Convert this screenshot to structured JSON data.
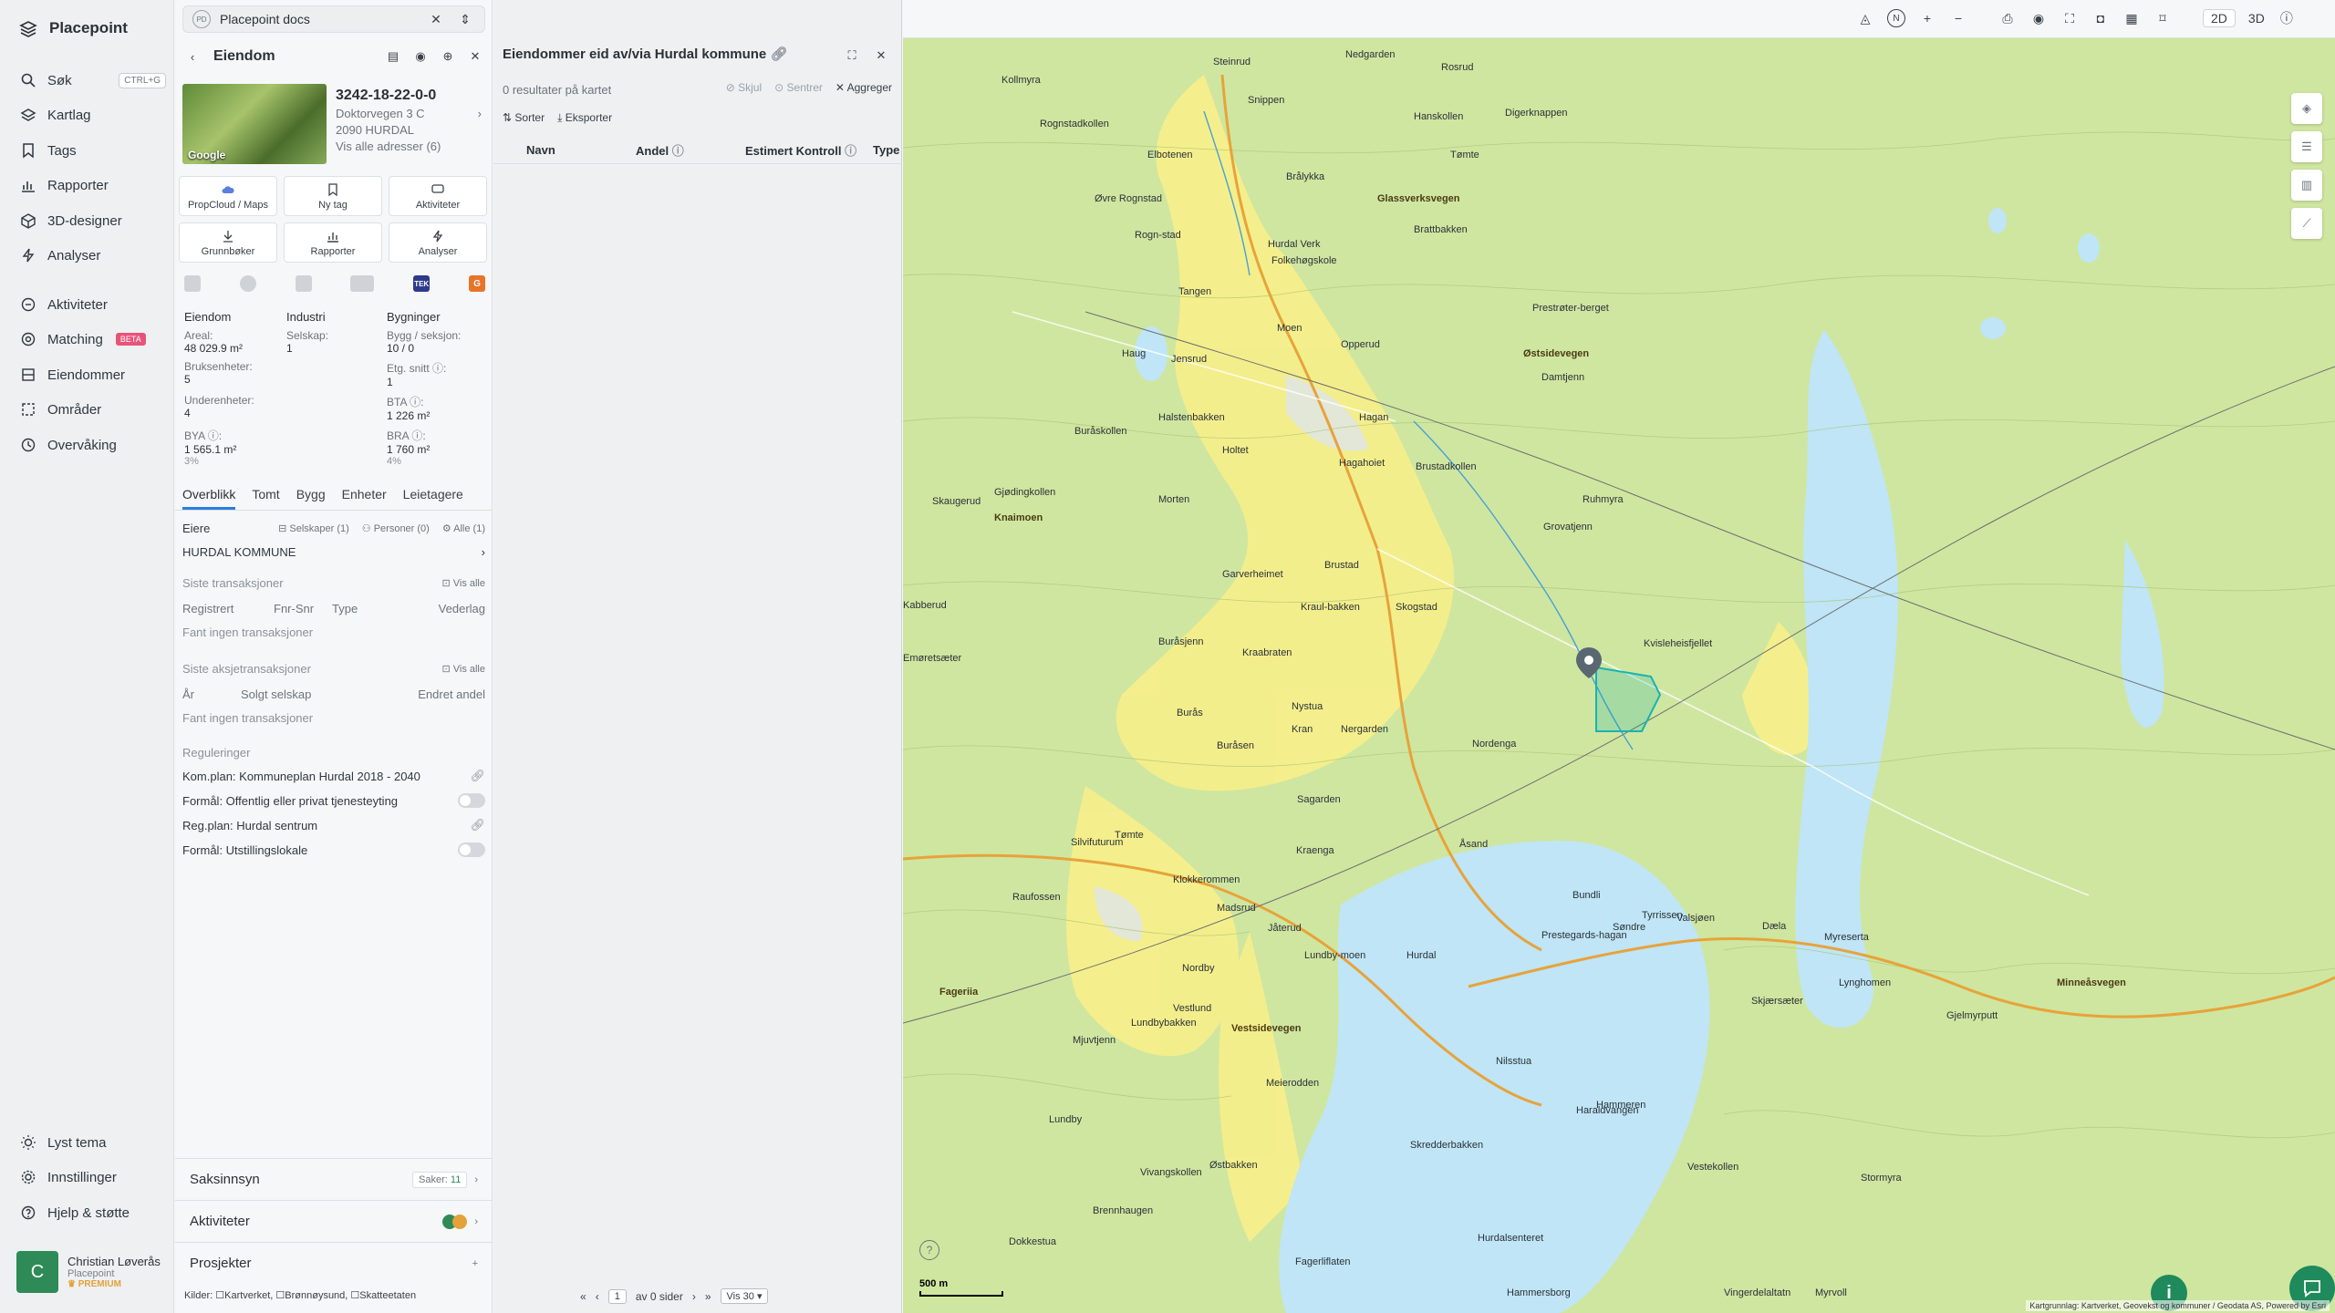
{
  "app": {
    "name": "Placepoint"
  },
  "nav": {
    "items": [
      {
        "label": "Søk",
        "shortcut": "CTRL+G"
      },
      {
        "label": "Kartlag"
      },
      {
        "label": "Tags"
      },
      {
        "label": "Rapporter"
      },
      {
        "label": "3D-designer"
      },
      {
        "label": "Analyser"
      },
      {
        "label": "Aktiviteter"
      },
      {
        "label": "Matching",
        "badge": "BETA"
      },
      {
        "label": "Eiendommer"
      },
      {
        "label": "Områder"
      },
      {
        "label": "Overvåking"
      }
    ],
    "bottom": [
      {
        "label": "Lyst tema"
      },
      {
        "label": "Innstillinger"
      },
      {
        "label": "Hjelp & støtte"
      }
    ],
    "user": {
      "initial": "C",
      "name": "Christian Løverås",
      "company": "Placepoint",
      "plan": "PREMIUM"
    }
  },
  "doc_tab": {
    "badge": "PD",
    "label": "Placepoint docs"
  },
  "property": {
    "header": "Eiendom",
    "id": "3242-18-22-0-0",
    "address": "Doktorvegen 3 C",
    "postal": "2090 HURDAL",
    "all_addresses": "Vis alle adresser (6)",
    "actions": [
      "PropCloud / Maps",
      "Ny tag",
      "Aktiviteter",
      "Grunnbøker",
      "Rapporter",
      "Analyser"
    ],
    "col_heads": [
      "Eiendom",
      "Industri",
      "Bygninger"
    ],
    "stats": {
      "areal_label": "Areal:",
      "areal": "48 029.9 m²",
      "selskap_label": "Selskap:",
      "selskap": "1",
      "bygg_label": "Bygg / seksjon:",
      "bygg": "10 / 0",
      "bruks_label": "Bruksenheter:",
      "bruks": "5",
      "etg_label": "Etg. snitt ⓘ:",
      "etg": "1",
      "under_label": "Underenheter:",
      "under": "4",
      "bta_label": "BTA ⓘ:",
      "bta": "1 226 m²",
      "bya_label": "BYA ⓘ:",
      "bya": "1 565.1 m²",
      "bya_pct": "3%",
      "bra_label": "BRA ⓘ:",
      "bra": "1 760 m²",
      "bra_pct": "4%"
    },
    "tabs": [
      "Overblikk",
      "Tomt",
      "Bygg",
      "Enheter",
      "Leietagere"
    ],
    "owners": {
      "label": "Eiere",
      "filters": [
        "Selskaper (1)",
        "Personer (0)",
        "Alle (1)"
      ],
      "owner": "HURDAL KOMMUNE"
    },
    "transactions": {
      "title": "Siste transaksjoner",
      "view_all": "Vis alle",
      "cols": [
        "Registrert",
        "Fnr-Snr",
        "Type",
        "Vederlag"
      ],
      "empty": "Fant ingen transaksjoner"
    },
    "share_tx": {
      "title": "Siste aksjetransaksjoner",
      "view_all": "Vis alle",
      "cols": [
        "År",
        "Solgt selskap",
        "Endret andel"
      ],
      "empty": "Fant ingen transaksjoner"
    },
    "regulations": {
      "title": "Reguleringer",
      "items": [
        "Kom.plan: Kommuneplan Hurdal 2018 - 2040",
        "Formål: Offentlig eller privat tjenesteyting",
        "Reg.plan: Hurdal sentrum",
        "Formål: Utstillingslokale"
      ]
    },
    "bottom": {
      "case": "Saksinnsyn",
      "case_count_label": "Saker:",
      "case_count": "11",
      "activities": "Aktiviteter",
      "projects": "Prosjekter"
    },
    "sources_label": "Kilder:",
    "sources": [
      "Kartverket",
      "Brønnøysund",
      "Skatteetaten"
    ]
  },
  "results": {
    "title": "Eiendommer eid av/via Hurdal kommune",
    "subtitle": "0 resultater på kartet",
    "tools": [
      "Skjul",
      "Sentrer",
      "Aggreger"
    ],
    "tools2": [
      "Sorter",
      "Eksporter"
    ],
    "columns": [
      "Navn",
      "Andel",
      "Estimert Kontroll",
      "Type"
    ],
    "pager": {
      "page": "1",
      "of": "av 0 sider",
      "per": "Vis 30"
    }
  },
  "map": {
    "mode_2d": "2D",
    "mode_3d": "3D",
    "scale": "500 m",
    "attribution": "Kartgrunnlag: Kartverket, Geovekst og kommuner / Geodata AS, Powered by Esri",
    "labels": [
      "Steinrud",
      "Nedgarden",
      "Rosrud",
      "Snippen",
      "Kollmyra",
      "Hanskollen",
      "Digerknappen",
      "Rognstadkollen",
      "Elbotenen",
      "Brålykka",
      "Tømte",
      "Øvre Rognstad",
      "Hurdal Verk",
      "Folkehøgskole",
      "Brattbakken",
      "Rogn-stad",
      "Tangen",
      "Moen",
      "Prestrøter-berget",
      "Haug",
      "Jensrud",
      "Opperud",
      "Damtjenn",
      "Buråskollen",
      "Halstenbakken",
      "Holtet",
      "Hagan",
      "Brustadkollen",
      "Gjødingkollen",
      "Skaugerud",
      "Morten",
      "Hagahoiet",
      "Ruhmyra",
      "Grovatjenn",
      "Garverheimet",
      "Brustad",
      "Skogstad",
      "Kvisleheisfjellet",
      "Kabberud",
      "Kraul-bakken",
      "Kraabraten",
      "Emøretsæter",
      "Nystua",
      "Kran",
      "Nergarden",
      "Nordenga",
      "Buråsjenn",
      "Burås",
      "Buråsen",
      "Sagarden",
      "Kraenga",
      "Åsand",
      "Silvifuturum",
      "Tømte",
      "Raufossen",
      "Klokkerommen",
      "Madsrud",
      "Jåterud",
      "Nordby",
      "Lundby-moen",
      "Hurdal",
      "Prestegards-hagan",
      "Søndre",
      "Bundli",
      "Tyrrissen",
      "Valsjøen",
      "Dæla",
      "Myreserta",
      "Lynghomen",
      "Mjuvtjenn",
      "Lundbybakken",
      "Vestlund",
      "Nilsstua",
      "Meierodden",
      "Lundby",
      "Vivangskollen",
      "Østbakken",
      "Skredderbakken",
      "Haraldvangen",
      "Hammeren",
      "Vestekollen",
      "Stormyra",
      "Dokkestua",
      "Brennhaugen",
      "Fagerliflaten",
      "Hurdalsenteret",
      "Hammersborg",
      "Myrvoll",
      "Vingerdelaltatn",
      "Gjelmyrputt",
      "Skjærsæter"
    ],
    "roads": [
      "Minneåsvegen",
      "Glassverksvegen",
      "Knaimoen",
      "Østsidevegen",
      "Vestsidevegen",
      "Fageriia"
    ]
  }
}
